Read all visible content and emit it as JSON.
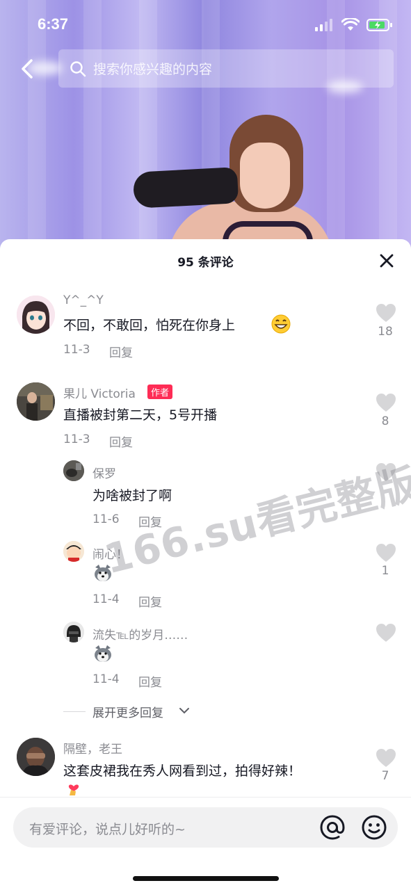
{
  "status_bar": {
    "time": "6:37"
  },
  "search": {
    "placeholder": "搜索你感兴趣的内容"
  },
  "comments_header": {
    "title": "95 条评论"
  },
  "comments": [
    {
      "user": "Y^_^Y",
      "text": "不回，不敢回，怕死在你身上",
      "emoji": "grinning-face",
      "date": "11-3",
      "reply_label": "回复",
      "likes": "18"
    },
    {
      "user": "果儿 Victoria",
      "badge": "作者",
      "text": "直播被封第二天，5号开播",
      "date": "11-3",
      "reply_label": "回复",
      "likes": "8",
      "replies": [
        {
          "user": "保罗",
          "text": "为啥被封了啊",
          "date": "11-6",
          "reply_label": "回复",
          "likes": ""
        },
        {
          "user": "闹心！",
          "emoji": "husky-dog",
          "date": "11-4",
          "reply_label": "回复",
          "likes": "1"
        },
        {
          "user": "流失℡的岁月……",
          "emoji": "husky-dog",
          "date": "11-4",
          "reply_label": "回复",
          "likes": ""
        }
      ],
      "expand_label": "展开更多回复"
    },
    {
      "user": "隔壁，老王",
      "text": "这套皮裙我在秀人网看到过，拍得好辣！",
      "emoji": "heart-hand",
      "likes": "7"
    }
  ],
  "watermark": "166.su看完整版",
  "input": {
    "placeholder": "有爱评论，说点儿好听的~"
  },
  "colors": {
    "accent": "#fe2c55",
    "text": "#161823",
    "meta": "#8a8b91"
  }
}
